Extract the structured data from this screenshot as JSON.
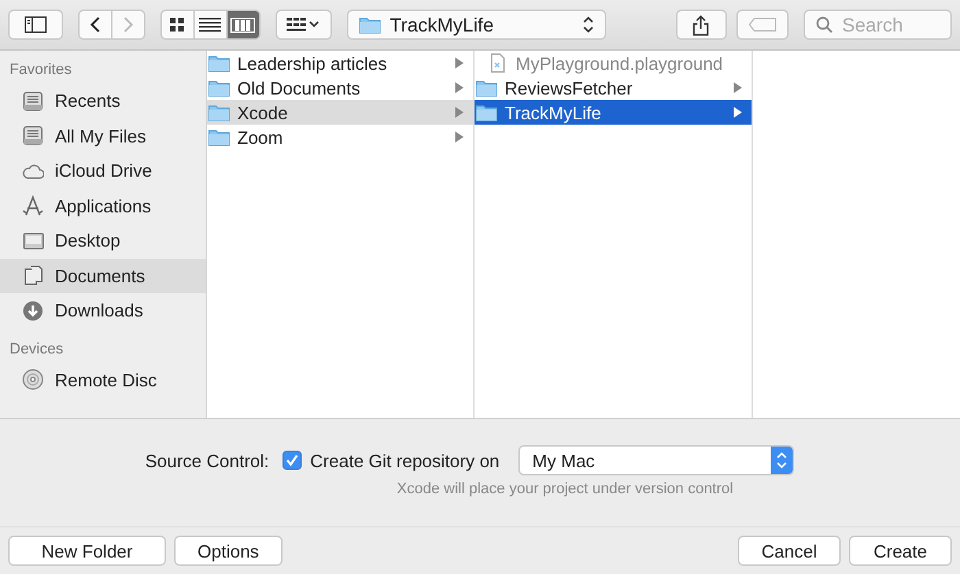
{
  "toolbar": {
    "back": {
      "disabled": false
    },
    "forward": {
      "disabled": true
    },
    "view_modes": [
      {
        "kind": "icons",
        "selected": false
      },
      {
        "kind": "list",
        "selected": false
      },
      {
        "kind": "columns",
        "selected": true
      }
    ],
    "location": "TrackMyLife",
    "search": {
      "placeholder": "Search"
    }
  },
  "sidebar": {
    "sections": [
      {
        "heading": "Favorites",
        "items": [
          {
            "label": "Recents",
            "kind": "tray",
            "selected": false
          },
          {
            "label": "All My Files",
            "kind": "tray",
            "selected": false
          },
          {
            "label": "iCloud Drive",
            "kind": "cloud",
            "selected": false
          },
          {
            "label": "Applications",
            "kind": "apps",
            "selected": false
          },
          {
            "label": "Desktop",
            "kind": "desktop",
            "selected": false
          },
          {
            "label": "Documents",
            "kind": "documents",
            "selected": true
          },
          {
            "label": "Downloads",
            "kind": "downloads",
            "selected": false
          }
        ]
      },
      {
        "heading": "Devices",
        "items": [
          {
            "label": "Remote Disc",
            "kind": "disc",
            "selected": false
          }
        ]
      }
    ]
  },
  "columns": [
    {
      "items": [
        {
          "label": "Leadership articles",
          "kind": "folder",
          "expandable": true,
          "selected": false
        },
        {
          "label": "Old Documents",
          "kind": "folder",
          "expandable": true,
          "selected": false
        },
        {
          "label": "Xcode",
          "kind": "folder",
          "expandable": true,
          "selected": true
        },
        {
          "label": "Zoom",
          "kind": "folder",
          "expandable": true,
          "selected": false
        }
      ]
    },
    {
      "items": [
        {
          "label": "MyPlayground.playground",
          "kind": "file",
          "expandable": false,
          "selected": false
        },
        {
          "label": "ReviewsFetcher",
          "kind": "folder",
          "expandable": true,
          "selected": false
        },
        {
          "label": "TrackMyLife",
          "kind": "folder",
          "expandable": true,
          "selected": true
        }
      ]
    }
  ],
  "source_control": {
    "label": "Source Control:",
    "checkbox": {
      "label": "Create Git repository on",
      "checked": true
    },
    "popup": "My Mac",
    "note": "Xcode will place your project under version control"
  },
  "buttons_left": [
    "New Folder",
    "Options"
  ],
  "buttons_right": [
    "Cancel",
    "Create"
  ]
}
